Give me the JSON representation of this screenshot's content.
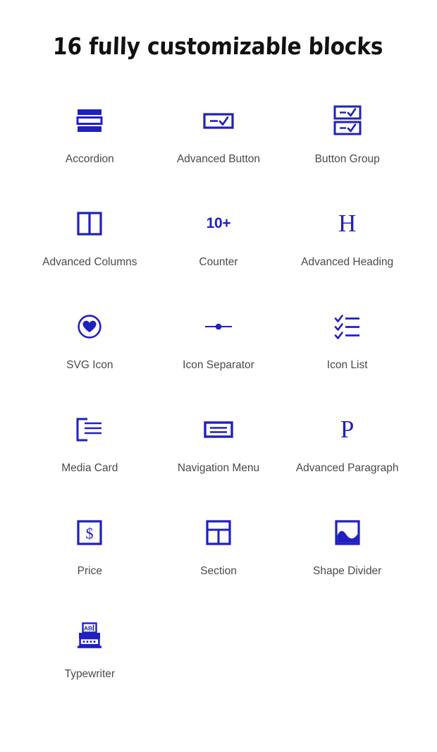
{
  "header": {
    "title": "16 fully customizable blocks"
  },
  "theme": {
    "accent_color": "#2020c0",
    "label_color": "#4a4a4a",
    "title_color": "#111111",
    "background_color": "#ffffff"
  },
  "blocks": [
    {
      "label": "Accordion",
      "icon": "accordion-icon"
    },
    {
      "label": "Advanced Button",
      "icon": "advanced-button-icon"
    },
    {
      "label": "Button Group",
      "icon": "button-group-icon"
    },
    {
      "label": "Advanced Columns",
      "icon": "advanced-columns-icon"
    },
    {
      "label": "Counter",
      "icon": "counter-icon",
      "glyph": "10+"
    },
    {
      "label": "Advanced Heading",
      "icon": "advanced-heading-icon",
      "glyph": "H"
    },
    {
      "label": "SVG Icon",
      "icon": "svg-icon-heart-icon"
    },
    {
      "label": "Icon Separator",
      "icon": "icon-separator-icon"
    },
    {
      "label": "Icon List",
      "icon": "icon-list-icon"
    },
    {
      "label": "Media Card",
      "icon": "media-card-icon"
    },
    {
      "label": "Navigation Menu",
      "icon": "navigation-menu-icon"
    },
    {
      "label": "Advanced Paragraph",
      "icon": "advanced-paragraph-icon",
      "glyph": "P"
    },
    {
      "label": "Price",
      "icon": "price-icon"
    },
    {
      "label": "Section",
      "icon": "section-icon"
    },
    {
      "label": "Shape Divider",
      "icon": "shape-divider-icon"
    },
    {
      "label": "Typewriter",
      "icon": "typewriter-icon",
      "glyph": "AB"
    }
  ]
}
